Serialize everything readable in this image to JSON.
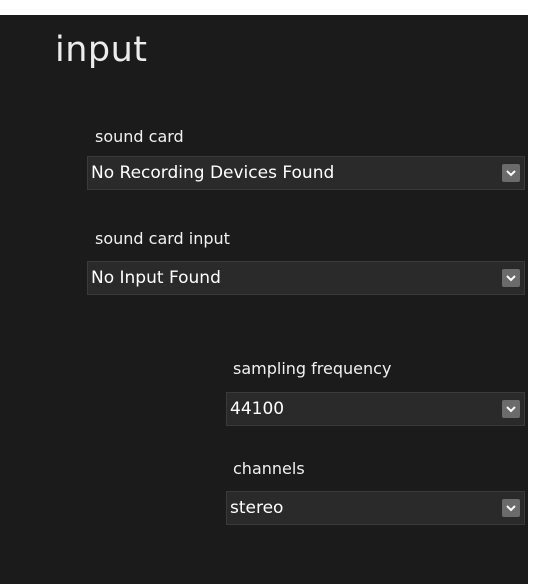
{
  "section": {
    "title": "input"
  },
  "sound_card": {
    "label": "sound card",
    "value": "No Recording Devices Found"
  },
  "sound_card_input": {
    "label": "sound card input",
    "value": "No Input Found"
  },
  "sampling_frequency": {
    "label": "sampling frequency",
    "value": "44100"
  },
  "channels": {
    "label": "channels",
    "value": "stereo"
  },
  "icons": {
    "dropdown": "chevron-down-icon"
  },
  "colors": {
    "panel_background": "#1b1b1b",
    "select_background": "#2a2a2a",
    "arrow_button": "#6b6b6b",
    "text": "#ffffff"
  }
}
